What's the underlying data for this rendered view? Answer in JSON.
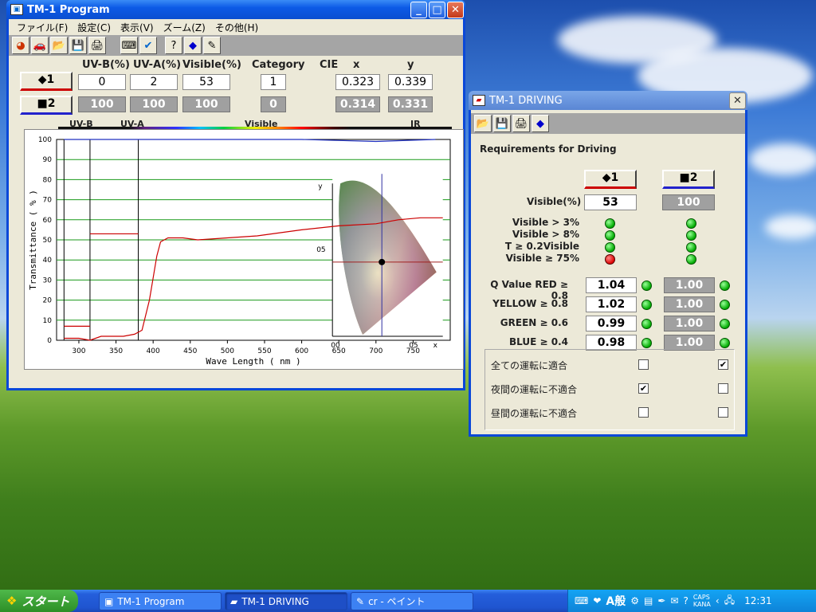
{
  "main_window": {
    "title": "TM-1 Program",
    "menu": [
      "ファイル(F)",
      "設定(C)",
      "表示(V)",
      "ズーム(Z)",
      "その他(H)"
    ],
    "headers": {
      "uvb": "UV-B(%)",
      "uva": "UV-A(%)",
      "visible": "Visible(%)",
      "category": "Category",
      "cie": "CIE",
      "x": "x",
      "y": "y"
    },
    "row1": {
      "label": "◆1",
      "uvb": "0",
      "uva": "2",
      "visible": "53",
      "category": "1",
      "x": "0.323",
      "y": "0.339"
    },
    "row2": {
      "label": "■2",
      "uvb": "100",
      "uva": "100",
      "visible": "100",
      "category": "0",
      "x": "0.314",
      "y": "0.331"
    },
    "spectrum_labels": {
      "uvb": "UV-B",
      "uva": "UV-A",
      "visible": "Visible",
      "ir": "IR"
    }
  },
  "chart_data": {
    "type": "line",
    "xlabel": "Wave Length  ( nm )",
    "ylabel": "Transmittance  ( % )",
    "xlim": [
      270,
      800
    ],
    "ylim": [
      0,
      100
    ],
    "x_ticks": [
      "300",
      "350",
      "400",
      "450",
      "500",
      "550",
      "600",
      "650",
      "700",
      "750"
    ],
    "y_ticks": [
      "0",
      "10",
      "20",
      "30",
      "40",
      "50",
      "60",
      "70",
      "80",
      "90",
      "100"
    ],
    "grid": true,
    "band_dividers": [
      280,
      315,
      380
    ],
    "series": [
      {
        "color": "#cc0000",
        "x": [
          280,
          300,
          315,
          330,
          360,
          375,
          385,
          395,
          405,
          410,
          420,
          440,
          460,
          500,
          540,
          600,
          650,
          700,
          730,
          760,
          790
        ],
        "values": [
          1,
          1,
          0,
          2,
          2,
          3,
          5,
          20,
          42,
          49,
          51,
          51,
          50,
          51,
          52,
          55,
          57,
          58,
          60,
          61,
          61
        ]
      },
      {
        "color": "#2030c0",
        "x": [
          280,
          400,
          500,
          600,
          700,
          780
        ],
        "values": [
          100,
          100,
          100,
          100,
          99,
          100
        ]
      }
    ],
    "uv_band_levels": [
      {
        "from": 280,
        "to": 315,
        "value": 7
      },
      {
        "from": 315,
        "to": 380,
        "value": 53
      }
    ],
    "cie_inset": {
      "x_ticks": [
        "00",
        "05",
        "x"
      ],
      "y_ticks": [
        "05",
        "y"
      ]
    }
  },
  "driving_window": {
    "title": "TM-1 DRIVING",
    "heading": "Requirements for Driving",
    "btn1": "◆1",
    "btn2": "■2",
    "visible_label": "Visible(%)",
    "visible1": "53",
    "visible2": "100",
    "criteria": [
      "Visible > 3%",
      "Visible > 8%",
      "T ≥ 0.2Visible",
      "Visible ≥ 75%"
    ],
    "criteria_status1": [
      "green",
      "green",
      "green",
      "red"
    ],
    "criteria_status2": [
      "green",
      "green",
      "green",
      "green"
    ],
    "q": [
      {
        "label": "Q Value  RED ≥ 0.8",
        "v1": "1.04",
        "v2": "1.00"
      },
      {
        "label": "YELLOW ≥ 0.8",
        "v1": "1.02",
        "v2": "1.00"
      },
      {
        "label": "GREEN ≥ 0.6",
        "v1": "0.99",
        "v2": "1.00"
      },
      {
        "label": "BLUE ≥ 0.4",
        "v1": "0.98",
        "v2": "1.00"
      }
    ],
    "checks": [
      {
        "label": "全ての運転に適合",
        "c1": false,
        "c2": true
      },
      {
        "label": "夜間の運転に不適合",
        "c1": true,
        "c2": false
      },
      {
        "label": "昼間の運転に不適合",
        "c1": false,
        "c2": false
      }
    ]
  },
  "taskbar": {
    "start": "スタート",
    "items": [
      "TM-1 Program",
      "TM-1 DRIVING",
      "cr - ペイント"
    ],
    "ime": "A般",
    "caps": "CAPS",
    "kana": "KANA",
    "clock": "12:31"
  }
}
